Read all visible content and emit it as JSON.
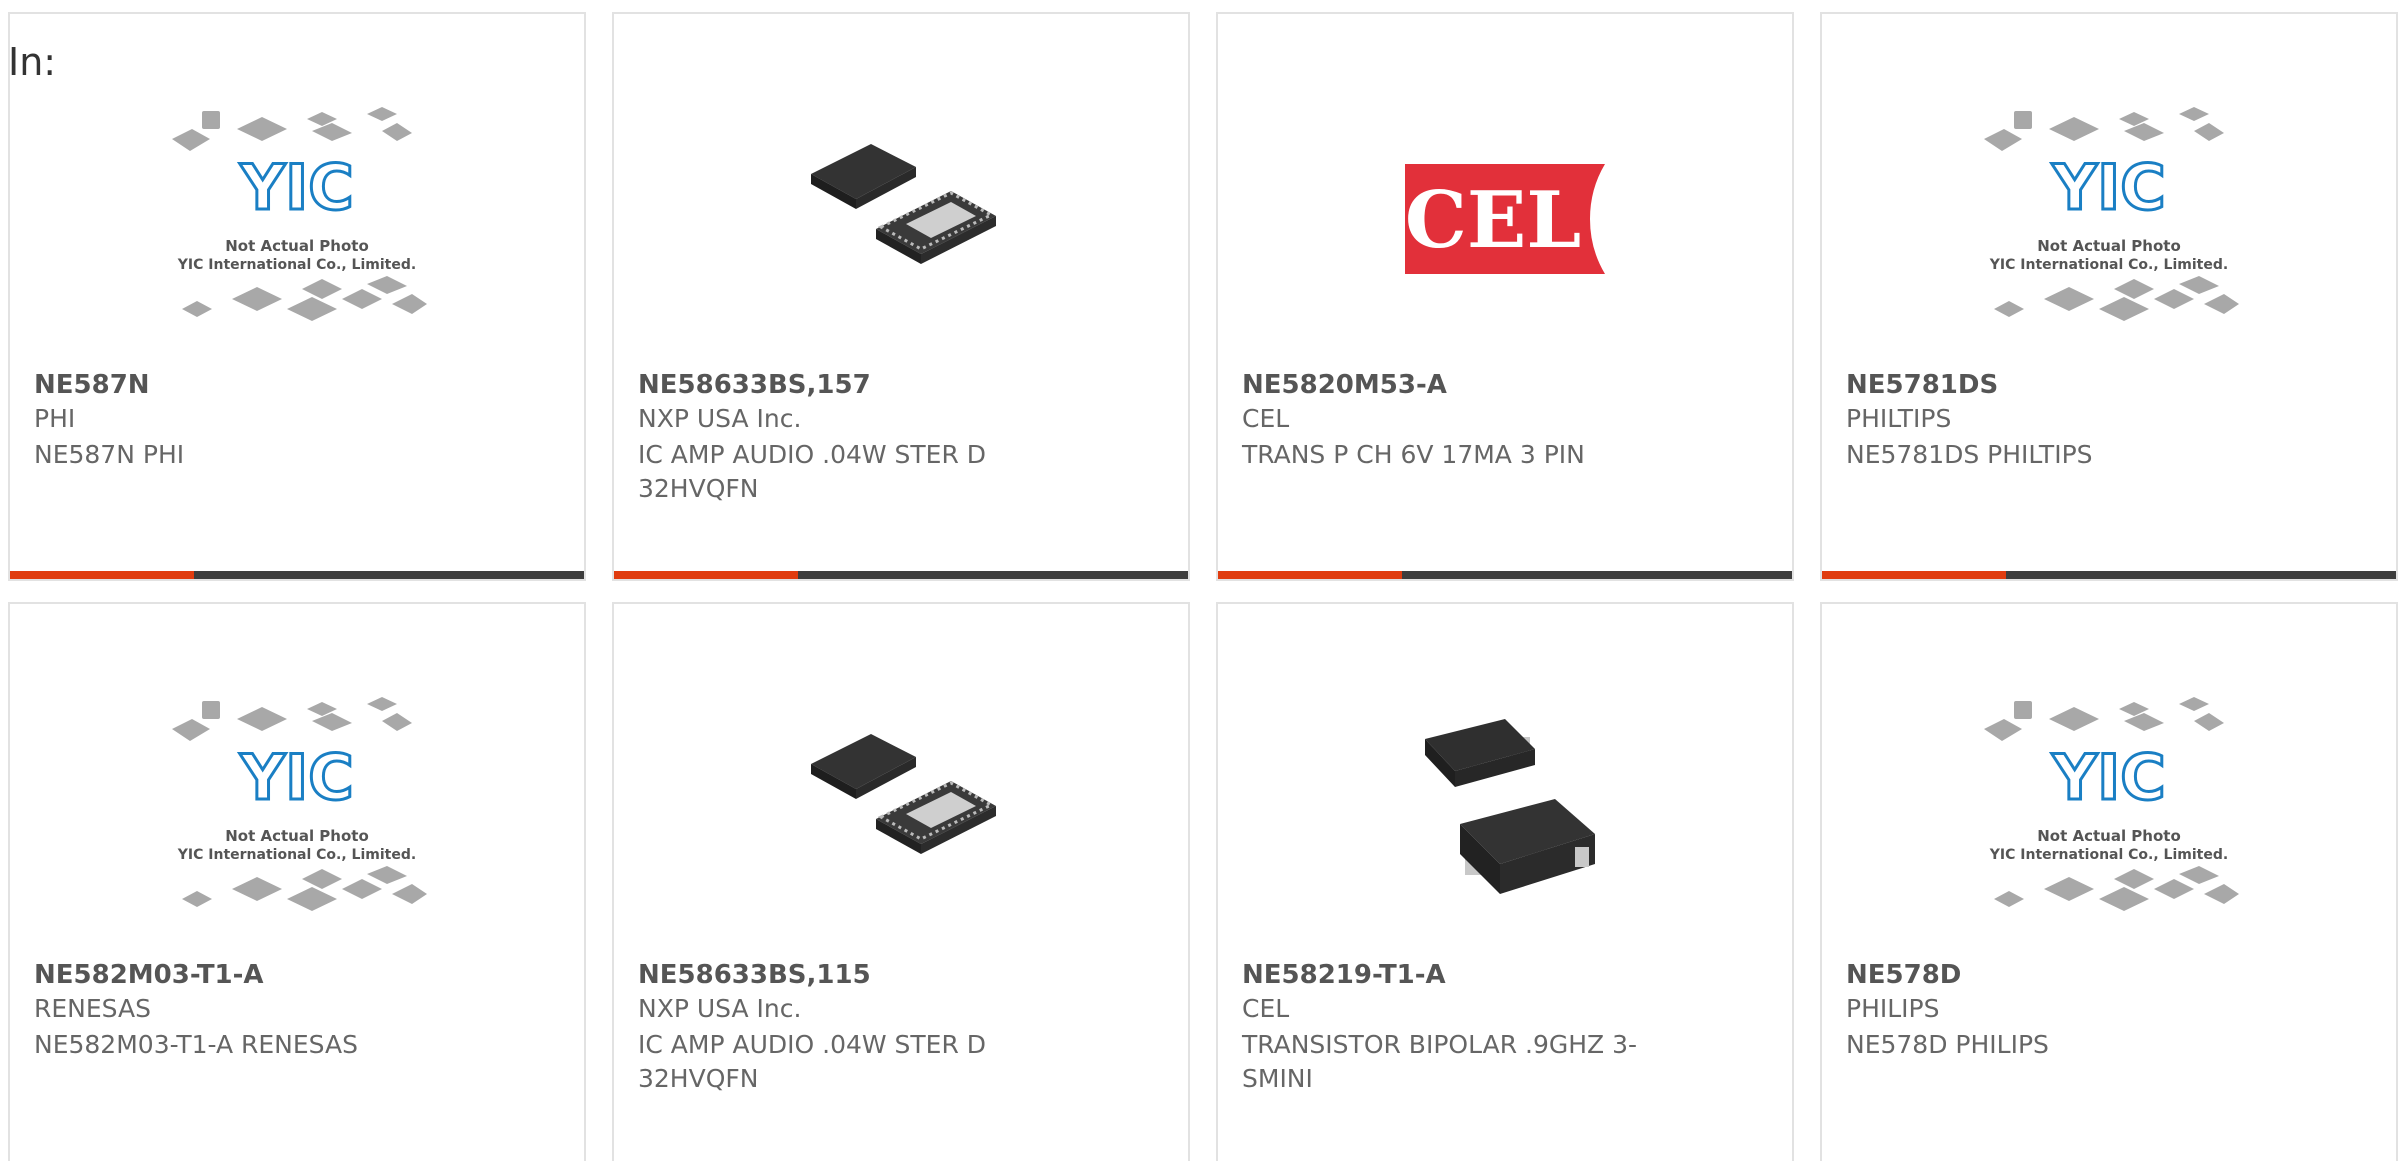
{
  "header": {
    "label": "In:"
  },
  "products": [
    {
      "part": "NE587N",
      "manufacturer": "PHI",
      "description": "NE587N PHI",
      "image": "placeholder-photo"
    },
    {
      "part": "NE58633BS,157",
      "manufacturer": "NXP USA Inc.",
      "description": "IC AMP AUDIO .04W STER D 32HVQFN",
      "image": "qfn-chip-photo"
    },
    {
      "part": "NE5820M53-A",
      "manufacturer": "CEL",
      "description": "TRANS P CH 6V 17MA 3 PIN",
      "image": "cel-logo"
    },
    {
      "part": "NE5781DS",
      "manufacturer": "PHILTIPS",
      "description": "NE5781DS PHILTIPS",
      "image": "placeholder-photo"
    },
    {
      "part": "NE582M03-T1-A",
      "manufacturer": "RENESAS",
      "description": "NE582M03-T1-A RENESAS",
      "image": "placeholder-photo"
    },
    {
      "part": "NE58633BS,115",
      "manufacturer": "NXP USA Inc.",
      "description": "IC AMP AUDIO .04W STER D 32HVQFN",
      "image": "qfn-chip-photo"
    },
    {
      "part": "NE58219-T1-A",
      "manufacturer": "CEL",
      "description": "TRANSISTOR BIPOLAR .9GHZ 3-SMINI",
      "image": "sot-transistor-photo"
    },
    {
      "part": "NE578D",
      "manufacturer": "PHILIPS",
      "description": "NE578D PHILIPS",
      "image": "placeholder-photo"
    }
  ],
  "placeholder": {
    "logo": "YIC",
    "line1": "Not Actual Photo",
    "line2": "YIC International Co., Limited."
  },
  "brand_logo_text": "CEL",
  "colors": {
    "accent": "#e03c0f",
    "bar": "#3d3d3d",
    "border": "#e2e2e2",
    "yic_blue": "#1a7fc4",
    "cel_red": "#e2303a"
  }
}
